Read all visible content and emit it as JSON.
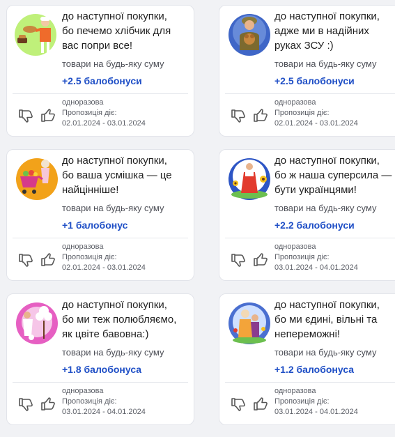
{
  "offers": [
    {
      "title": "до наступної покупки,\nбо печемо хлібчик для\nвас попри все!",
      "condition": "товари на будь-яку суму",
      "bonus": "+2.5 балобонуси",
      "frequency": "одноразова",
      "validity_label": "Пропозиція діє:",
      "validity_dates": "02.01.2024 - 03.01.2024",
      "illustration": "baker-illustration",
      "accent": "#ef6b2b"
    },
    {
      "title": "до наступної покупки,\nадже ми в надійних\nруках ЗСУ :)",
      "condition": "товари на будь-яку суму",
      "bonus": "+2.5 балобонуси",
      "frequency": "одноразова",
      "validity_label": "Пропозиція діє:",
      "validity_dates": "02.01.2024 - 03.01.2024",
      "illustration": "soldier-illustration",
      "accent": "#3f66c7"
    },
    {
      "title": "до наступної покупки,\nбо ваша усмішка — це\nнайцінніше!",
      "condition": "товари на будь-яку суму",
      "bonus": "+1 балобонус",
      "frequency": "одноразова",
      "validity_label": "Пропозиція діє:",
      "validity_dates": "02.01.2024 - 03.01.2024",
      "illustration": "shopping-cart-illustration",
      "accent": "#f2a21a"
    },
    {
      "title": "до наступної покупки,\nбо ж наша суперсила —\nбути українцями!",
      "condition": "товари на будь-яку суму",
      "bonus": "+2.2 балобонуси",
      "frequency": "одноразова",
      "validity_label": "Пропозиція діє:",
      "validity_dates": "03.01.2024 - 04.01.2024",
      "illustration": "sunflower-woman-illustration",
      "accent": "#2d55c5"
    },
    {
      "title": "до наступної покупки,\nбо ми теж полюбляємо,\nяк цвіте бавовна:)",
      "condition": "товари на будь-яку суму",
      "bonus": "+1.8 балобонуса",
      "frequency": "одноразова",
      "validity_label": "Пропозиція діє:",
      "validity_dates": "03.01.2024 - 04.01.2024",
      "illustration": "cotton-illustration",
      "accent": "#e65fc2"
    },
    {
      "title": "до наступної покупки,\nбо ми єдині, вільні та\nнепереможні!",
      "condition": "товари на будь-яку суму",
      "bonus": "+1.2 балобонуса",
      "frequency": "одноразова",
      "validity_label": "Пропозиція діє:",
      "validity_dates": "03.01.2024 - 04.01.2024",
      "illustration": "couple-illustration",
      "accent": "#4a6fd0"
    }
  ],
  "actions": {
    "dislike_icon": "thumbs-down-icon",
    "like_icon": "thumbs-up-icon"
  }
}
